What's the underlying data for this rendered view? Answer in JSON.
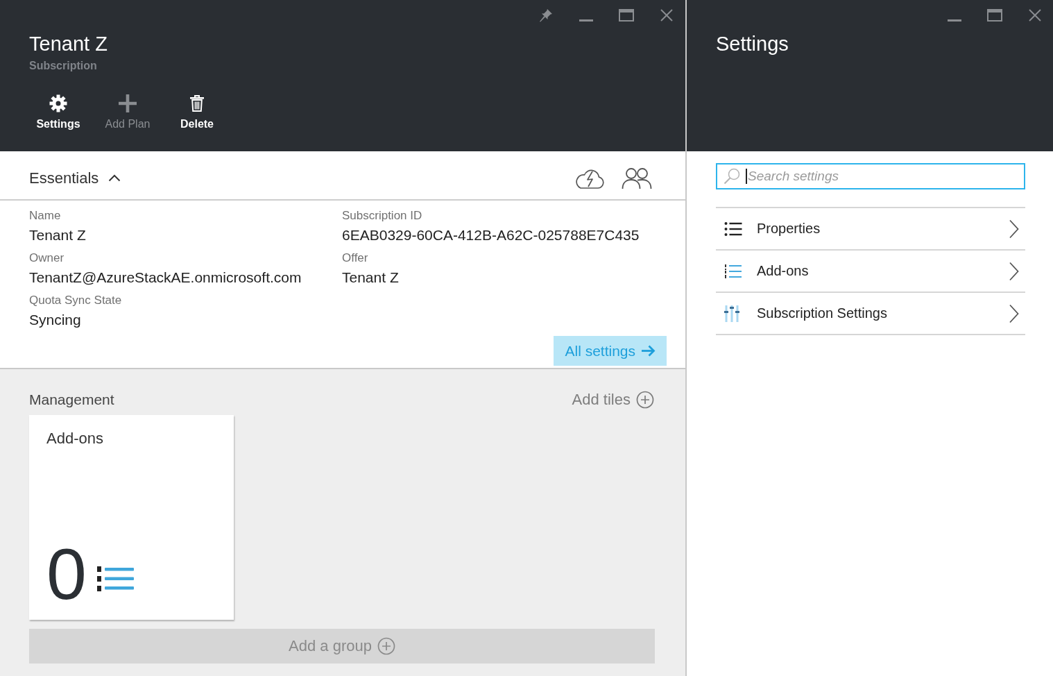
{
  "main_blade": {
    "title": "Tenant Z",
    "subtitle": "Subscription",
    "commands": [
      {
        "label": "Settings",
        "kind": "settings",
        "disabled": false
      },
      {
        "label": "Add Plan",
        "kind": "add",
        "disabled": true
      },
      {
        "label": "Delete",
        "kind": "delete",
        "disabled": false
      }
    ]
  },
  "essentials": {
    "title": "Essentials",
    "expanded": true,
    "fields": [
      {
        "label": "Name",
        "value": "Tenant Z"
      },
      {
        "label": "Subscription ID",
        "value": "6EAB0329-60CA-412B-A62C-025788E7C435"
      },
      {
        "label": "Owner",
        "value": "TenantZ@AzureStackAE.onmicrosoft.com"
      },
      {
        "label": "Offer",
        "value": "Tenant Z"
      },
      {
        "label": "Quota Sync State",
        "value": "Syncing"
      }
    ],
    "all_settings": "All settings"
  },
  "management": {
    "title": "Management",
    "add_tiles": "Add tiles",
    "tiles": [
      {
        "title": "Add-ons",
        "count": "0"
      }
    ],
    "add_group": "Add a group"
  },
  "settings_blade": {
    "title": "Settings",
    "search": {
      "placeholder": "Search settings",
      "focused": true
    },
    "items": [
      {
        "label": "Properties",
        "kind": "properties"
      },
      {
        "label": "Add-ons",
        "kind": "addons"
      },
      {
        "label": "Subscription Settings",
        "kind": "sliders"
      }
    ]
  }
}
